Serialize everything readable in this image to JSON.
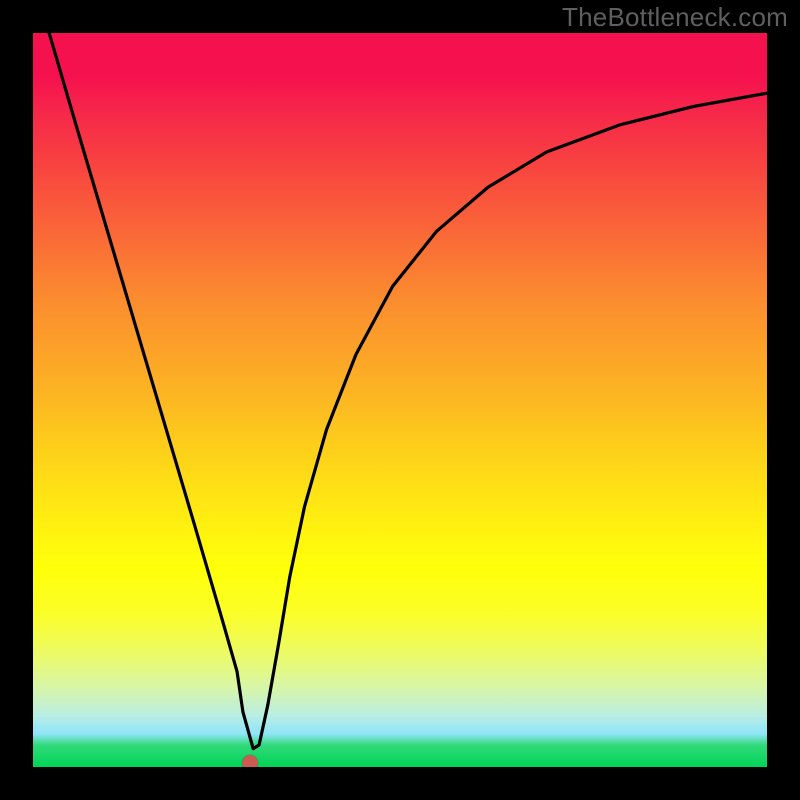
{
  "watermark": "TheBottleneck.com",
  "chart_data": {
    "type": "line",
    "title": "",
    "xlabel": "",
    "ylabel": "",
    "xlim": [
      0,
      1
    ],
    "ylim": [
      0,
      1
    ],
    "axes_visible": false,
    "background_gradient": [
      {
        "pos": 0.0,
        "color": "#f5114e"
      },
      {
        "pos": 0.5,
        "color": "#fcb124"
      },
      {
        "pos": 0.72,
        "color": "#ffff0a"
      },
      {
        "pos": 0.97,
        "color": "#32d97a"
      },
      {
        "pos": 1.0,
        "color": "#00d556"
      }
    ],
    "series": [
      {
        "name": "bottleneck-curve",
        "color": "#000000",
        "x": [
          0.022,
          0.06,
          0.1,
          0.14,
          0.18,
          0.22,
          0.258,
          0.278,
          0.286,
          0.3,
          0.308,
          0.32,
          0.335,
          0.35,
          0.37,
          0.4,
          0.44,
          0.49,
          0.55,
          0.62,
          0.7,
          0.8,
          0.9,
          1.0
        ],
        "y": [
          1.0,
          0.87,
          0.735,
          0.6,
          0.465,
          0.33,
          0.2,
          0.13,
          0.075,
          0.025,
          0.03,
          0.085,
          0.17,
          0.26,
          0.355,
          0.46,
          0.562,
          0.655,
          0.73,
          0.79,
          0.838,
          0.875,
          0.9,
          0.918
        ],
        "note": "y is plotted with origin at bottom (1 = top of plot, 0 = bottom green band)"
      }
    ],
    "marker": {
      "name": "minimum-dot",
      "x": 0.295,
      "y": 0.005,
      "color": "#cc5b51"
    }
  }
}
